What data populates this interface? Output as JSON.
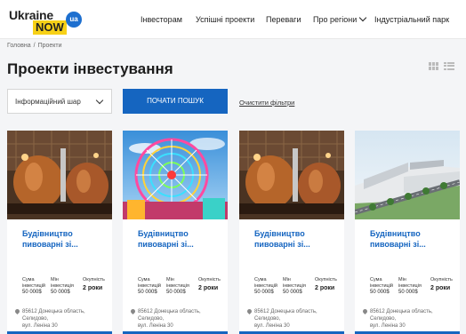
{
  "header": {
    "logo": {
      "main": "Ukraine",
      "sub": "NOW",
      "badge": "ua"
    },
    "nav": [
      {
        "label": "Інвесторам"
      },
      {
        "label": "Успішні проекти"
      },
      {
        "label": "Переваги"
      },
      {
        "label": "Про регіони",
        "dropdown": true
      },
      {
        "label": "Індустріальний парк"
      }
    ]
  },
  "breadcrumb": {
    "home": "Головна",
    "separator": "/",
    "current": "Проекти"
  },
  "page": {
    "title": "Проекти інвестування"
  },
  "filters": {
    "select_value": "Інформаційний шар",
    "search_button": "ПОЧАТИ ПОШУК",
    "clear_link": "Очистити фільтри"
  },
  "cards": [
    {
      "image": "brewery-copper-tanks",
      "title_line1": "Будівництво",
      "title_line2": "пивоварні зі...",
      "stat1_label1": "Сума",
      "stat1_label2": "інвестицій",
      "stat1_value": "50 000$",
      "stat2_label1": "Мін",
      "stat2_label2": "інвестиція",
      "stat2_value": "50 000$",
      "stat3_label": "Окупність",
      "stat3_value": "2 роки",
      "address_line1": "85612 Донецька область,",
      "address_line2": "Селидово,",
      "address_line3": "вул. Леніна 30"
    },
    {
      "image": "ferris-wheel",
      "title_line1": "Будівництво",
      "title_line2": "пивоварні зі...",
      "stat1_label1": "Сума",
      "stat1_label2": "інвестицій",
      "stat1_value": "50 000$",
      "stat2_label1": "Мін",
      "stat2_label2": "інвестиція",
      "stat2_value": "50 000$",
      "stat3_label": "Окупність",
      "stat3_value": "2 роки",
      "address_line1": "85612 Донецька область,",
      "address_line2": "Селидово,",
      "address_line3": "вул. Леніна 30"
    },
    {
      "image": "brewery-copper-tanks",
      "title_line1": "Будівництво",
      "title_line2": "пивоварні зі...",
      "stat1_label1": "Сума",
      "stat1_label2": "інвестицій",
      "stat1_value": "50 000$",
      "stat2_label1": "Мін",
      "stat2_label2": "інвестиція",
      "stat2_value": "50 000$",
      "stat3_label": "Окупність",
      "stat3_value": "2 роки",
      "address_line1": "85612 Донецька область,",
      "address_line2": "Селидово,",
      "address_line3": "вул. Леніна 30"
    },
    {
      "image": "industrial-park-buildings",
      "title_line1": "Будівництво",
      "title_line2": "пивоварні зі...",
      "stat1_label1": "Сума",
      "stat1_label2": "інвестицій",
      "stat1_value": "50 000$",
      "stat2_label1": "Мін",
      "stat2_label2": "інвестиція",
      "stat2_value": "50 000$",
      "stat3_label": "Окупність",
      "stat3_value": "2 роки",
      "address_line1": "85612 Донецька область,",
      "address_line2": "Селидово,",
      "address_line3": "вул. Леніна 30"
    }
  ],
  "colors": {
    "accent": "#1565c0",
    "logo_yellow": "#f7d117",
    "logo_badge": "#1d6fcf"
  }
}
